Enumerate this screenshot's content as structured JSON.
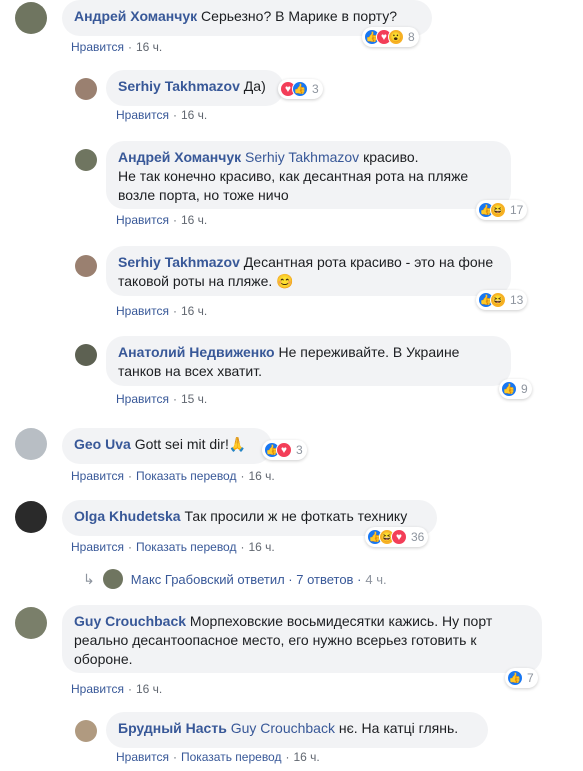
{
  "comments": [
    {
      "id": "c1",
      "author": "Андрей Хоманчук",
      "mention": "",
      "text": "Серьезно? В Марике в порту?",
      "like": "Нравится",
      "translate": "",
      "time": "16 ч.",
      "reactions": [
        "like",
        "love",
        "wow"
      ],
      "count": "8"
    },
    {
      "id": "c2",
      "author": "Serhiy Takhmazov",
      "mention": "",
      "text": "Да)",
      "like": "Нравится",
      "translate": "",
      "time": "16 ч.",
      "reactions": [
        "love",
        "like"
      ],
      "count": "3"
    },
    {
      "id": "c3",
      "author": "Андрей Хоманчук",
      "mention": "Serhiy Takhmazov",
      "text": "красиво.",
      "text2": "Не так конечно красиво, как десантная рота на пляже",
      "text3": "возле порта, но тоже ничо",
      "like": "Нравится",
      "translate": "",
      "time": "16 ч.",
      "reactions": [
        "like",
        "haha"
      ],
      "count": "17"
    },
    {
      "id": "c4",
      "author": "Serhiy Takhmazov",
      "mention": "",
      "text": "Десантная рота красиво - это на фоне",
      "text2": "таковой роты на пляже. 😊",
      "like": "Нравится",
      "translate": "",
      "time": "16 ч.",
      "reactions": [
        "like",
        "haha"
      ],
      "count": "13"
    },
    {
      "id": "c5",
      "author": "Анатолий Недвиженко",
      "mention": "",
      "text": "Не переживайте. В Украине",
      "text2": "танков на всех хватит.",
      "like": "Нравится",
      "translate": "",
      "time": "15 ч.",
      "reactions": [
        "like"
      ],
      "count": "9"
    },
    {
      "id": "c6",
      "author": "Geo Uva",
      "mention": "",
      "text": "Gott sei mit dir!🙏",
      "like": "Нравится",
      "translate": "Показать перевод",
      "time": "16 ч.",
      "reactions": [
        "like",
        "love"
      ],
      "count": "3"
    },
    {
      "id": "c7",
      "author": "Olga Khudetska",
      "mention": "",
      "text": "Так просили ж не фоткать технику",
      "like": "Нравится",
      "translate": "Показать перевод",
      "time": "16 ч.",
      "reactions": [
        "like",
        "haha",
        "love"
      ],
      "count": "36"
    },
    {
      "id": "c8",
      "author": "Guy Crouchback",
      "mention": "",
      "text": "Морпеховские восьмидесятки кажись. Ну порт",
      "text2": "реально десантоопасное место, его нужно всерьез готовить к",
      "text3": "обороне.",
      "like": "Нравится",
      "translate": "",
      "time": "16 ч.",
      "reactions": [
        "like"
      ],
      "count": "7"
    },
    {
      "id": "c9",
      "author": "Брудный Насть",
      "mention": "Guy Crouchback",
      "text": "нє. На катці глянь.",
      "like": "Нравится",
      "translate": "Показать перевод",
      "time": "16 ч.",
      "reactions": [],
      "count": ""
    }
  ],
  "reply_summary": {
    "text": "Макс Грабовский ответил · 7 ответов · ",
    "time": "4 ч."
  },
  "colors": {
    "link": "#385898",
    "bubble": "#f2f3f5",
    "like": "#1877f2",
    "love": "#f33e58",
    "haha": "#f7b125"
  }
}
